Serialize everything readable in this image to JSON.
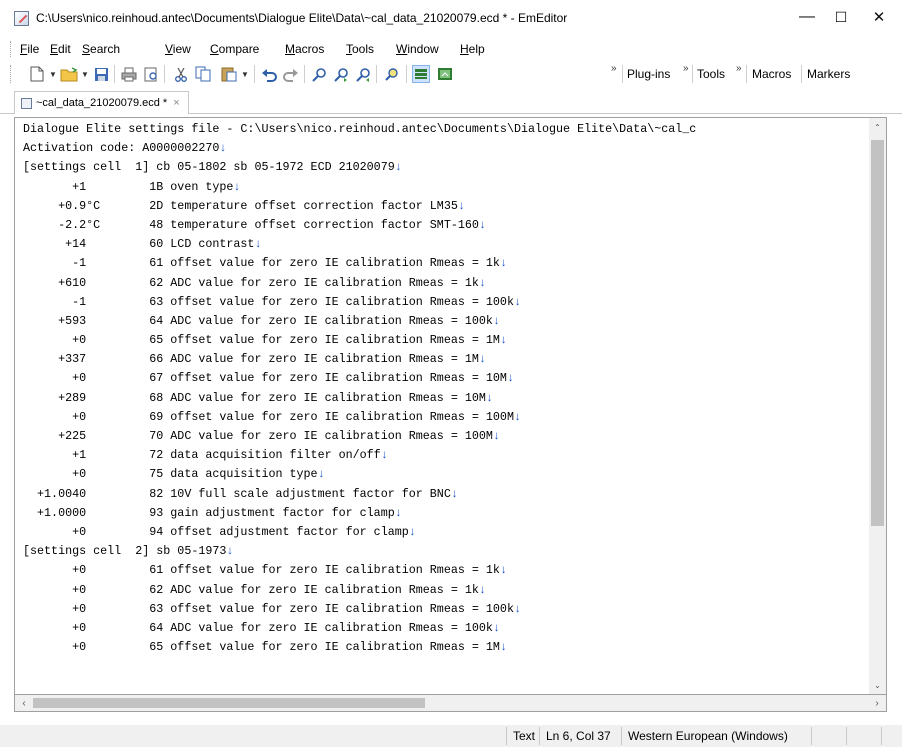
{
  "window": {
    "title": "C:\\Users\\nico.reinhoud.antec\\Documents\\Dialogue Elite\\Data\\~cal_data_21020079.ecd * - EmEditor",
    "minimize": "—",
    "maximize": "☐",
    "close": "✕"
  },
  "menu": {
    "items": [
      {
        "accel": "F",
        "rest": "ile"
      },
      {
        "accel": "E",
        "rest": "dit"
      },
      {
        "accel": "S",
        "rest": "earch"
      },
      {
        "accel": "V",
        "rest": "iew"
      },
      {
        "accel": "C",
        "rest": "ompare"
      },
      {
        "accel": "M",
        "rest": "acros"
      },
      {
        "accel": "T",
        "rest": "ools"
      },
      {
        "accel": "W",
        "rest": "indow"
      },
      {
        "accel": "H",
        "rest": "elp"
      }
    ]
  },
  "toolbar": {
    "chevron": "»",
    "plugins_label": "Plug-ins",
    "tools_label": "Tools",
    "macros_label": "Macros",
    "markers_label": "Markers"
  },
  "tab": {
    "label": "~cal_data_21020079.ecd *",
    "close": "×"
  },
  "editor": {
    "eol_mark": "↓",
    "lines": [
      {
        "text": "Dialogue Elite settings file - C:\\Users\\nico.reinhoud.antec\\Documents\\Dialogue Elite\\Data\\~cal_c",
        "eol": false
      },
      {
        "text": "Activation code: A0000002270",
        "eol": true
      },
      {
        "text": "[settings cell  1] cb 05-1802 sb 05-1972 ECD 21020079",
        "eol": true
      },
      {
        "text": "       +1         1B oven type",
        "eol": true
      },
      {
        "text": "     +0.9°C       2D temperature offset correction factor LM35",
        "eol": true
      },
      {
        "text": "     -2.2°C       48 temperature offset correction factor SMT-160",
        "eol": true
      },
      {
        "text": "      +14         60 LCD contrast",
        "eol": true
      },
      {
        "text": "       -1         61 offset value for zero IE calibration Rmeas = 1k",
        "eol": true
      },
      {
        "text": "     +610         62 ADC value for zero IE calibration Rmeas = 1k",
        "eol": true
      },
      {
        "text": "       -1         63 offset value for zero IE calibration Rmeas = 100k",
        "eol": true
      },
      {
        "text": "     +593         64 ADC value for zero IE calibration Rmeas = 100k",
        "eol": true
      },
      {
        "text": "       +0         65 offset value for zero IE calibration Rmeas = 1M",
        "eol": true
      },
      {
        "text": "     +337         66 ADC value for zero IE calibration Rmeas = 1M",
        "eol": true
      },
      {
        "text": "       +0         67 offset value for zero IE calibration Rmeas = 10M",
        "eol": true
      },
      {
        "text": "     +289         68 ADC value for zero IE calibration Rmeas = 10M",
        "eol": true
      },
      {
        "text": "       +0         69 offset value for zero IE calibration Rmeas = 100M",
        "eol": true
      },
      {
        "text": "     +225         70 ADC value for zero IE calibration Rmeas = 100M",
        "eol": true
      },
      {
        "text": "       +1         72 data acquisition filter on/off",
        "eol": true
      },
      {
        "text": "       +0         75 data acquisition type",
        "eol": true
      },
      {
        "text": "  +1.0040         82 10V full scale adjustment factor for BNC",
        "eol": true
      },
      {
        "text": "  +1.0000         93 gain adjustment factor for clamp",
        "eol": true
      },
      {
        "text": "       +0         94 offset adjustment factor for clamp",
        "eol": true
      },
      {
        "text": "[settings cell  2] sb 05-1973",
        "eol": true
      },
      {
        "text": "       +0         61 offset value for zero IE calibration Rmeas = 1k",
        "eol": true
      },
      {
        "text": "       +0         62 ADC value for zero IE calibration Rmeas = 1k",
        "eol": true
      },
      {
        "text": "       +0         63 offset value for zero IE calibration Rmeas = 100k",
        "eol": true
      },
      {
        "text": "       +0         64 ADC value for zero IE calibration Rmeas = 100k",
        "eol": true
      },
      {
        "text": "       +0         65 offset value for zero IE calibration Rmeas = 1M",
        "eol": true
      }
    ]
  },
  "scroll": {
    "up": "⌃",
    "down": "⌄",
    "left": "‹",
    "right": "›"
  },
  "status": {
    "mode": "Text",
    "position": "Ln 6, Col 37",
    "encoding": "Western European (Windows)"
  }
}
